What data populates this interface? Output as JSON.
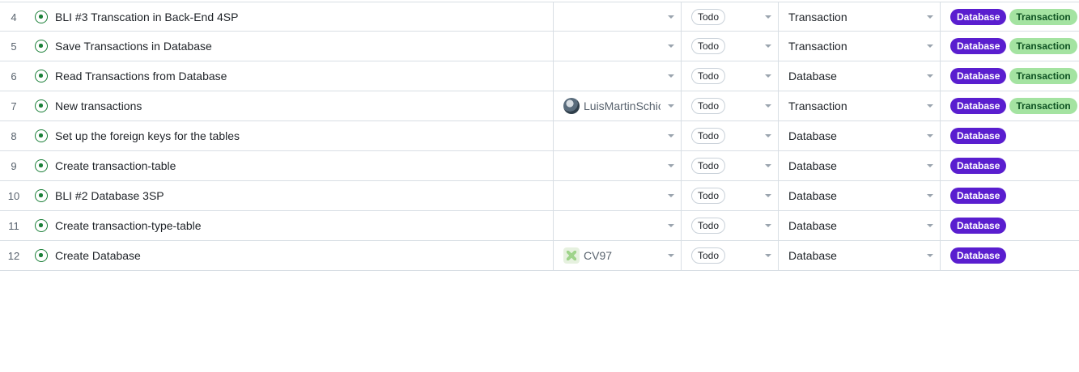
{
  "rows": [
    {
      "num": "4",
      "title": "BLI #3 Transcation in Back-End 4SP",
      "assignee": "",
      "avatar": "",
      "status": "Todo",
      "type": "Transaction",
      "labels": [
        "Database",
        "Transaction"
      ]
    },
    {
      "num": "5",
      "title": "Save Transactions in Database",
      "assignee": "",
      "avatar": "",
      "status": "Todo",
      "type": "Transaction",
      "labels": [
        "Database",
        "Transaction"
      ]
    },
    {
      "num": "6",
      "title": "Read Transactions from Database",
      "assignee": "",
      "avatar": "",
      "status": "Todo",
      "type": "Database",
      "labels": [
        "Database",
        "Transaction"
      ]
    },
    {
      "num": "7",
      "title": "New transactions",
      "assignee": "LuisMartinSchic",
      "avatar": "photo",
      "status": "Todo",
      "type": "Transaction",
      "labels": [
        "Database",
        "Transaction"
      ]
    },
    {
      "num": "8",
      "title": "Set up the foreign keys for the tables",
      "assignee": "",
      "avatar": "",
      "status": "Todo",
      "type": "Database",
      "labels": [
        "Database"
      ]
    },
    {
      "num": "9",
      "title": "Create transaction-table",
      "assignee": "",
      "avatar": "",
      "status": "Todo",
      "type": "Database",
      "labels": [
        "Database"
      ]
    },
    {
      "num": "10",
      "title": "BLI #2 Database 3SP",
      "assignee": "",
      "avatar": "",
      "status": "Todo",
      "type": "Database",
      "labels": [
        "Database"
      ]
    },
    {
      "num": "11",
      "title": "Create transaction-type-table",
      "assignee": "",
      "avatar": "",
      "status": "Todo",
      "type": "Database",
      "labels": [
        "Database"
      ]
    },
    {
      "num": "12",
      "title": "Create Database",
      "assignee": "CV97",
      "avatar": "identicon",
      "status": "Todo",
      "type": "Database",
      "labels": [
        "Database"
      ]
    }
  ],
  "icons": {
    "issue": "open-issue-icon",
    "dropdown": "chevron-down-icon"
  },
  "colors": {
    "issue_open": "#1a7f37",
    "label_database": "#5a1ecf",
    "label_transaction": "#a4e3a1"
  }
}
